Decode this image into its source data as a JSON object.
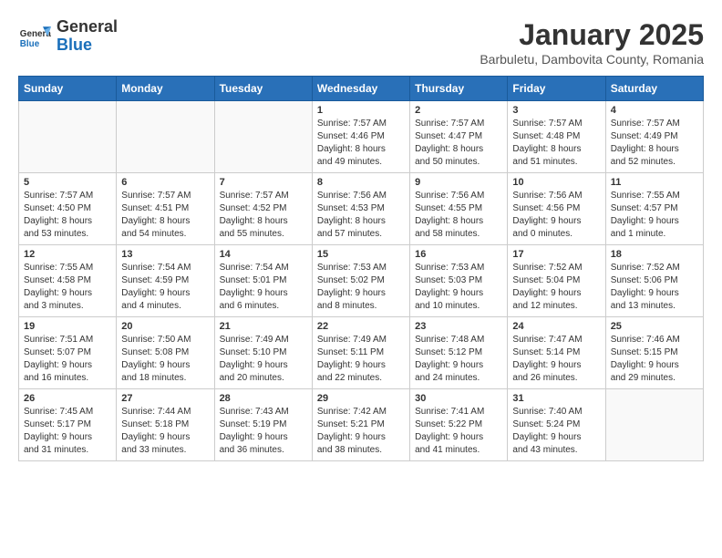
{
  "header": {
    "logo_line1": "General",
    "logo_line2": "Blue",
    "title": "January 2025",
    "subtitle": "Barbuletu, Dambovita County, Romania"
  },
  "weekdays": [
    "Sunday",
    "Monday",
    "Tuesday",
    "Wednesday",
    "Thursday",
    "Friday",
    "Saturday"
  ],
  "weeks": [
    [
      {
        "day": "",
        "info": ""
      },
      {
        "day": "",
        "info": ""
      },
      {
        "day": "",
        "info": ""
      },
      {
        "day": "1",
        "info": "Sunrise: 7:57 AM\nSunset: 4:46 PM\nDaylight: 8 hours\nand 49 minutes."
      },
      {
        "day": "2",
        "info": "Sunrise: 7:57 AM\nSunset: 4:47 PM\nDaylight: 8 hours\nand 50 minutes."
      },
      {
        "day": "3",
        "info": "Sunrise: 7:57 AM\nSunset: 4:48 PM\nDaylight: 8 hours\nand 51 minutes."
      },
      {
        "day": "4",
        "info": "Sunrise: 7:57 AM\nSunset: 4:49 PM\nDaylight: 8 hours\nand 52 minutes."
      }
    ],
    [
      {
        "day": "5",
        "info": "Sunrise: 7:57 AM\nSunset: 4:50 PM\nDaylight: 8 hours\nand 53 minutes."
      },
      {
        "day": "6",
        "info": "Sunrise: 7:57 AM\nSunset: 4:51 PM\nDaylight: 8 hours\nand 54 minutes."
      },
      {
        "day": "7",
        "info": "Sunrise: 7:57 AM\nSunset: 4:52 PM\nDaylight: 8 hours\nand 55 minutes."
      },
      {
        "day": "8",
        "info": "Sunrise: 7:56 AM\nSunset: 4:53 PM\nDaylight: 8 hours\nand 57 minutes."
      },
      {
        "day": "9",
        "info": "Sunrise: 7:56 AM\nSunset: 4:55 PM\nDaylight: 8 hours\nand 58 minutes."
      },
      {
        "day": "10",
        "info": "Sunrise: 7:56 AM\nSunset: 4:56 PM\nDaylight: 9 hours\nand 0 minutes."
      },
      {
        "day": "11",
        "info": "Sunrise: 7:55 AM\nSunset: 4:57 PM\nDaylight: 9 hours\nand 1 minute."
      }
    ],
    [
      {
        "day": "12",
        "info": "Sunrise: 7:55 AM\nSunset: 4:58 PM\nDaylight: 9 hours\nand 3 minutes."
      },
      {
        "day": "13",
        "info": "Sunrise: 7:54 AM\nSunset: 4:59 PM\nDaylight: 9 hours\nand 4 minutes."
      },
      {
        "day": "14",
        "info": "Sunrise: 7:54 AM\nSunset: 5:01 PM\nDaylight: 9 hours\nand 6 minutes."
      },
      {
        "day": "15",
        "info": "Sunrise: 7:53 AM\nSunset: 5:02 PM\nDaylight: 9 hours\nand 8 minutes."
      },
      {
        "day": "16",
        "info": "Sunrise: 7:53 AM\nSunset: 5:03 PM\nDaylight: 9 hours\nand 10 minutes."
      },
      {
        "day": "17",
        "info": "Sunrise: 7:52 AM\nSunset: 5:04 PM\nDaylight: 9 hours\nand 12 minutes."
      },
      {
        "day": "18",
        "info": "Sunrise: 7:52 AM\nSunset: 5:06 PM\nDaylight: 9 hours\nand 13 minutes."
      }
    ],
    [
      {
        "day": "19",
        "info": "Sunrise: 7:51 AM\nSunset: 5:07 PM\nDaylight: 9 hours\nand 16 minutes."
      },
      {
        "day": "20",
        "info": "Sunrise: 7:50 AM\nSunset: 5:08 PM\nDaylight: 9 hours\nand 18 minutes."
      },
      {
        "day": "21",
        "info": "Sunrise: 7:49 AM\nSunset: 5:10 PM\nDaylight: 9 hours\nand 20 minutes."
      },
      {
        "day": "22",
        "info": "Sunrise: 7:49 AM\nSunset: 5:11 PM\nDaylight: 9 hours\nand 22 minutes."
      },
      {
        "day": "23",
        "info": "Sunrise: 7:48 AM\nSunset: 5:12 PM\nDaylight: 9 hours\nand 24 minutes."
      },
      {
        "day": "24",
        "info": "Sunrise: 7:47 AM\nSunset: 5:14 PM\nDaylight: 9 hours\nand 26 minutes."
      },
      {
        "day": "25",
        "info": "Sunrise: 7:46 AM\nSunset: 5:15 PM\nDaylight: 9 hours\nand 29 minutes."
      }
    ],
    [
      {
        "day": "26",
        "info": "Sunrise: 7:45 AM\nSunset: 5:17 PM\nDaylight: 9 hours\nand 31 minutes."
      },
      {
        "day": "27",
        "info": "Sunrise: 7:44 AM\nSunset: 5:18 PM\nDaylight: 9 hours\nand 33 minutes."
      },
      {
        "day": "28",
        "info": "Sunrise: 7:43 AM\nSunset: 5:19 PM\nDaylight: 9 hours\nand 36 minutes."
      },
      {
        "day": "29",
        "info": "Sunrise: 7:42 AM\nSunset: 5:21 PM\nDaylight: 9 hours\nand 38 minutes."
      },
      {
        "day": "30",
        "info": "Sunrise: 7:41 AM\nSunset: 5:22 PM\nDaylight: 9 hours\nand 41 minutes."
      },
      {
        "day": "31",
        "info": "Sunrise: 7:40 AM\nSunset: 5:24 PM\nDaylight: 9 hours\nand 43 minutes."
      },
      {
        "day": "",
        "info": ""
      }
    ]
  ]
}
